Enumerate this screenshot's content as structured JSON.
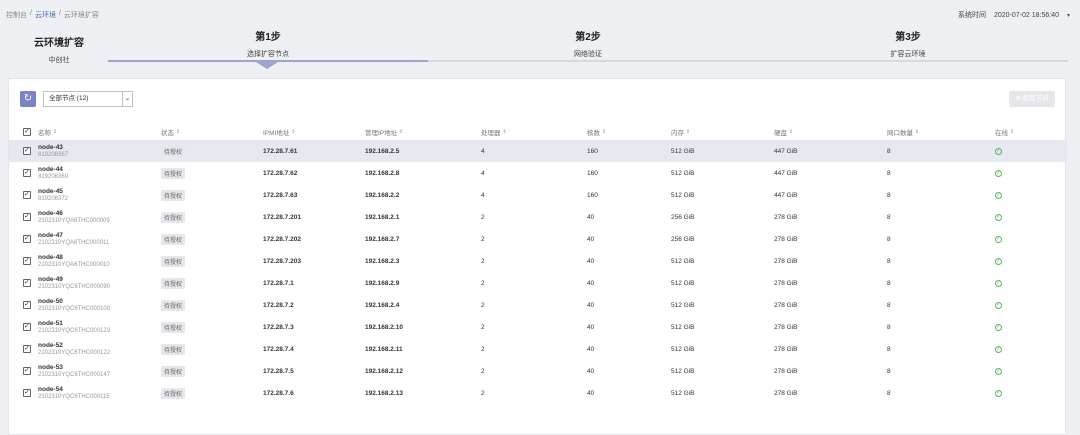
{
  "breadcrumb": [
    "控制台",
    "云环境",
    "云环境扩容"
  ],
  "system_time": {
    "label": "系统时间",
    "value": "2020-07-02 18:56:40",
    "caret": "▾"
  },
  "env": {
    "title": "云环境扩容",
    "subtitle": "中创社"
  },
  "steps": [
    {
      "number": "第1步",
      "label": "选择扩容节点"
    },
    {
      "number": "第2步",
      "label": "网络验证"
    },
    {
      "number": "第3步",
      "label": "扩容云环境"
    }
  ],
  "toolbar": {
    "refresh_icon": "↻",
    "filter_value": "全部节点 (12)",
    "filter_arrow": "⌄",
    "action_button": "⊕ 配置节点"
  },
  "columns": [
    "名称",
    "状态",
    "IPMI地址",
    "管理IP地址",
    "处理器",
    "核数",
    "内存",
    "硬盘",
    "网口数量",
    "在线"
  ],
  "sort_icon": "⇕",
  "rows": [
    {
      "name": "node-43",
      "sn": "819208367",
      "state": "待授权",
      "ipmi": "172.28.7.61",
      "mgmt": "192.168.2.5",
      "cpu": "4",
      "cores": "160",
      "mem": "512 GiB",
      "disk": "447 GiB",
      "nics": "8"
    },
    {
      "name": "node-44",
      "sn": "819208369",
      "state": "待授权",
      "ipmi": "172.28.7.62",
      "mgmt": "192.168.2.8",
      "cpu": "4",
      "cores": "160",
      "mem": "512 GiB",
      "disk": "447 GiB",
      "nics": "8"
    },
    {
      "name": "node-45",
      "sn": "819208372",
      "state": "待授权",
      "ipmi": "172.28.7.63",
      "mgmt": "192.168.2.2",
      "cpu": "4",
      "cores": "160",
      "mem": "512 GiB",
      "disk": "447 GiB",
      "nics": "8"
    },
    {
      "name": "node-46",
      "sn": "2102310YQA6THC000009",
      "state": "待授权",
      "ipmi": "172.28.7.201",
      "mgmt": "192.168.2.1",
      "cpu": "2",
      "cores": "40",
      "mem": "256 GiB",
      "disk": "278 GiB",
      "nics": "8"
    },
    {
      "name": "node-47",
      "sn": "2102310YQA6THC000011",
      "state": "待授权",
      "ipmi": "172.28.7.202",
      "mgmt": "192.168.2.7",
      "cpu": "2",
      "cores": "40",
      "mem": "256 GiB",
      "disk": "278 GiB",
      "nics": "8"
    },
    {
      "name": "node-48",
      "sn": "2102310YQA6THC000010",
      "state": "待授权",
      "ipmi": "172.28.7.203",
      "mgmt": "192.168.2.3",
      "cpu": "2",
      "cores": "40",
      "mem": "512 GiB",
      "disk": "278 GiB",
      "nics": "8"
    },
    {
      "name": "node-49",
      "sn": "2102310YQC6THC000090",
      "state": "待授权",
      "ipmi": "172.28.7.1",
      "mgmt": "192.168.2.9",
      "cpu": "2",
      "cores": "40",
      "mem": "512 GiB",
      "disk": "278 GiB",
      "nics": "8"
    },
    {
      "name": "node-50",
      "sn": "2102310YQC6THC000100",
      "state": "待授权",
      "ipmi": "172.28.7.2",
      "mgmt": "192.168.2.4",
      "cpu": "2",
      "cores": "40",
      "mem": "512 GiB",
      "disk": "278 GiB",
      "nics": "8"
    },
    {
      "name": "node-51",
      "sn": "2102310YQC6THC000123",
      "state": "待授权",
      "ipmi": "172.28.7.3",
      "mgmt": "192.168.2.10",
      "cpu": "2",
      "cores": "40",
      "mem": "512 GiB",
      "disk": "278 GiB",
      "nics": "8"
    },
    {
      "name": "node-52",
      "sn": "2102310YQC6THC000122",
      "state": "待授权",
      "ipmi": "172.28.7.4",
      "mgmt": "192.168.2.11",
      "cpu": "2",
      "cores": "40",
      "mem": "512 GiB",
      "disk": "278 GiB",
      "nics": "8"
    },
    {
      "name": "node-53",
      "sn": "2102310YQC6THC000147",
      "state": "待授权",
      "ipmi": "172.28.7.5",
      "mgmt": "192.168.2.12",
      "cpu": "2",
      "cores": "40",
      "mem": "512 GiB",
      "disk": "278 GiB",
      "nics": "8"
    },
    {
      "name": "node-54",
      "sn": "2102310YQC6THC000115",
      "state": "待授权",
      "ipmi": "172.28.7.6",
      "mgmt": "192.168.2.13",
      "cpu": "2",
      "cores": "40",
      "mem": "512 GiB",
      "disk": "278 GiB",
      "nics": "8"
    }
  ],
  "check_mark": "✓",
  "online_icon": "✓",
  "colors": {
    "accent": "#7a83c4",
    "online": "#5bb65b",
    "highlight_row": "#e6e9ef"
  }
}
